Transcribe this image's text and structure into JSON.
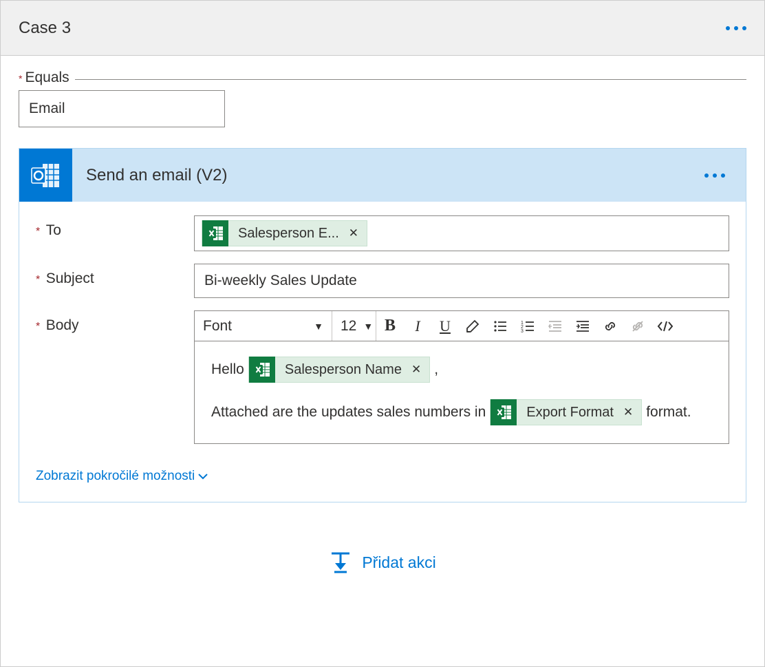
{
  "case": {
    "title": "Case 3"
  },
  "equals": {
    "label": "Equals",
    "value": "Email"
  },
  "action": {
    "title": "Send an email (V2)",
    "fields": {
      "to_label": "To",
      "to_token": "Salesperson E...",
      "subject_label": "Subject",
      "subject_value": "Bi-weekly Sales Update",
      "body_label": "Body"
    },
    "toolbar": {
      "font_label": "Font",
      "size_label": "12"
    },
    "body": {
      "line1_pre": "Hello",
      "line1_token": "Salesperson Name",
      "line1_post": ",",
      "line2_pre": "Attached are the updates sales numbers in",
      "line2_token": "Export Format",
      "line2_post": "format."
    },
    "advanced_link": "Zobrazit pokročilé možnosti"
  },
  "add_action": {
    "label": "Přidat akci"
  }
}
